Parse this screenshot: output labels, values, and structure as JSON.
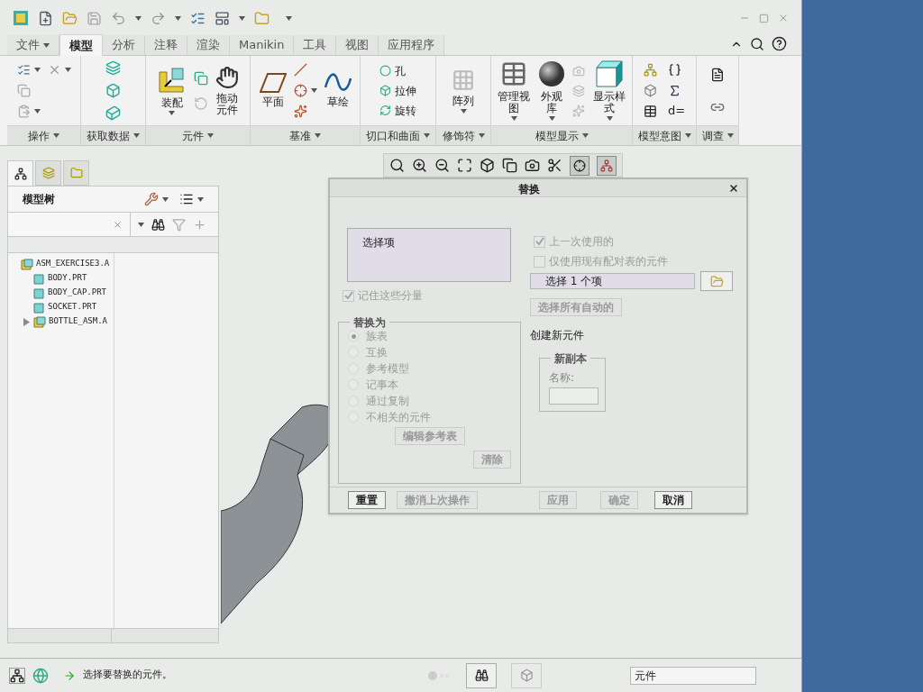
{
  "tabs": [
    {
      "label": "文件",
      "selected": false,
      "menu": true
    },
    {
      "label": "模型",
      "selected": true,
      "menu": false
    },
    {
      "label": "分析",
      "selected": false,
      "menu": false
    },
    {
      "label": "注释",
      "selected": false,
      "menu": false
    },
    {
      "label": "渲染",
      "selected": false,
      "menu": false
    },
    {
      "label": "Manikin",
      "selected": false,
      "menu": false
    },
    {
      "label": "工具",
      "selected": false,
      "menu": false
    },
    {
      "label": "视图",
      "selected": false,
      "menu": false
    },
    {
      "label": "应用程序",
      "selected": false,
      "menu": false
    }
  ],
  "ribbon": [
    {
      "label": "操作"
    },
    {
      "label": "获取数据"
    },
    {
      "label": "元件",
      "tools": [
        "装配",
        "拖动元件"
      ]
    },
    {
      "label": "基准",
      "tools": [
        "平面",
        "草绘"
      ]
    },
    {
      "label": "切口和曲面",
      "tools": [
        "孔",
        "拉伸",
        "旋转"
      ]
    },
    {
      "label": "修饰符",
      "tools": [
        "阵列"
      ]
    },
    {
      "label": "模型显示",
      "tools": [
        "管理视图",
        "外观库",
        "显示样式"
      ]
    },
    {
      "label": "模型意图",
      "tools": [
        "d="
      ]
    },
    {
      "label": "调查"
    }
  ],
  "navigator": {
    "tabs": [
      {
        "selected": true
      },
      {
        "selected": false
      },
      {
        "selected": false
      }
    ],
    "title": "模型树",
    "tree": [
      {
        "label": "ASM_EXERCISE3.A",
        "kind": "assembly",
        "children": [
          {
            "label": "BODY.PRT",
            "kind": "part"
          },
          {
            "label": "BODY_CAP.PRT",
            "kind": "part"
          },
          {
            "label": "SOCKET.PRT",
            "kind": "part"
          },
          {
            "label": "BOTTLE_ASM.A",
            "kind": "assembly",
            "expanded": false
          }
        ]
      }
    ]
  },
  "view_toolbar": {
    "toggles": [
      {
        "on": true
      },
      {
        "on": true
      }
    ]
  },
  "dialog": {
    "title": "替换",
    "list_header": "选择项",
    "remember": {
      "label": "记住这些分量",
      "checked": true,
      "disabled": true
    },
    "options": [
      {
        "label": "上一次使用的",
        "checked": true,
        "disabled": true
      },
      {
        "label": "仅使用现有配对表的元件",
        "checked": false,
        "disabled": true
      }
    ],
    "selection_field": "选择 1 个项",
    "select_auto_button": {
      "label": "选择所有自动的",
      "disabled": true
    },
    "replace_with": {
      "title": "替换为",
      "radios": [
        {
          "label": "族表",
          "selected": true,
          "disabled": true
        },
        {
          "label": "互换",
          "selected": false,
          "disabled": true
        },
        {
          "label": "参考模型",
          "selected": false,
          "disabled": true
        },
        {
          "label": "记事本",
          "selected": false,
          "disabled": true
        },
        {
          "label": "通过复制",
          "selected": false,
          "disabled": true
        },
        {
          "label": "不相关的元件",
          "selected": false,
          "disabled": true
        }
      ],
      "edit_button": {
        "label": "编辑参考表",
        "disabled": true
      },
      "clear_button": {
        "label": "清除",
        "disabled": true
      }
    },
    "create_label": "创建新元件",
    "new_copy": {
      "title": "新副本",
      "name_label": "名称:"
    },
    "buttons": [
      {
        "label": "重置",
        "disabled": false
      },
      {
        "label": "撤消上次操作",
        "disabled": true
      },
      {
        "label": "应用",
        "disabled": true
      },
      {
        "label": "确定",
        "disabled": true
      },
      {
        "label": "取消",
        "disabled": false
      }
    ]
  },
  "status_bar": {
    "message": "选择要替换的元件。",
    "filter": "元件"
  }
}
